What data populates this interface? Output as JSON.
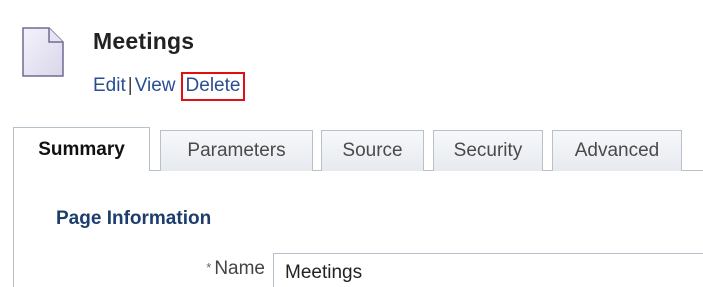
{
  "header": {
    "title": "Meetings",
    "icon": "page-icon"
  },
  "actions": {
    "edit_label": "Edit",
    "view_label": "View",
    "delete_label": "Delete",
    "separator": "|",
    "highlight_color": "#e01010",
    "link_color": "#2a4d93"
  },
  "tabs": [
    {
      "label": "Summary",
      "active": true
    },
    {
      "label": "Parameters",
      "active": false
    },
    {
      "label": "Source",
      "active": false
    },
    {
      "label": "Security",
      "active": false
    },
    {
      "label": "Advanced",
      "active": false
    }
  ],
  "section": {
    "title": "Page Information"
  },
  "fields": {
    "name": {
      "required_marker": "*",
      "label": "Name",
      "value": "Meetings"
    }
  }
}
